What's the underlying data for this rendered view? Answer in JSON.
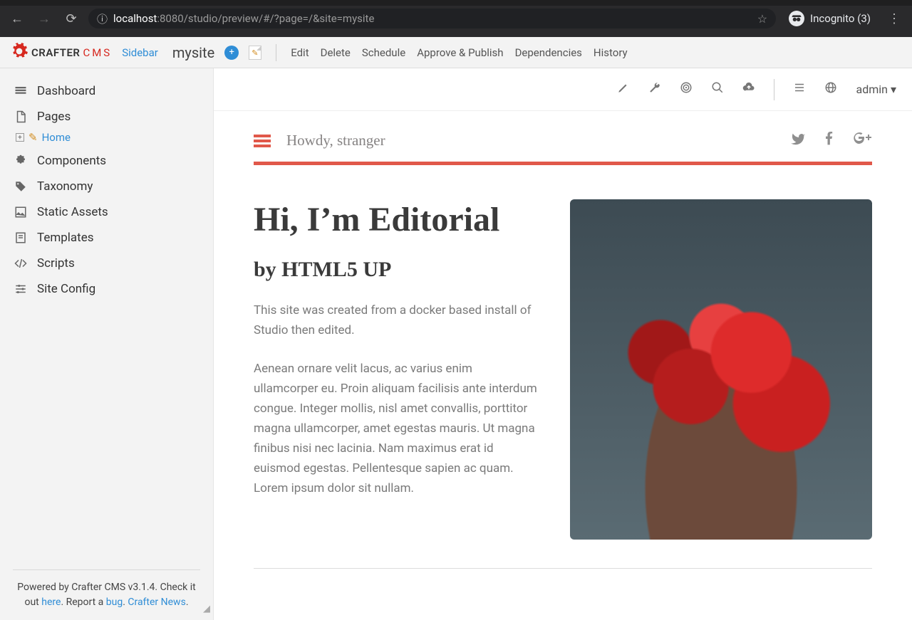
{
  "browser": {
    "url_host": "localhost",
    "url_port_path": ":8080/studio/preview/#/?page=/&site=mysite",
    "incognito_label": "Incognito (3)"
  },
  "topbar": {
    "sidebar_toggle": "Sidebar",
    "site_name": "mysite",
    "actions": {
      "edit": "Edit",
      "delete": "Delete",
      "schedule": "Schedule",
      "approve_publish": "Approve & Publish",
      "dependencies": "Dependencies",
      "history": "History"
    }
  },
  "sidebar": {
    "items": {
      "dashboard": "Dashboard",
      "pages": "Pages",
      "home": "Home",
      "components": "Components",
      "taxonomy": "Taxonomy",
      "static_assets": "Static Assets",
      "templates": "Templates",
      "scripts": "Scripts",
      "site_config": "Site Config"
    },
    "footer": {
      "p1a": "Powered by Crafter CMS v3.1.4. Check it out ",
      "here": "here",
      "p1b": ". Report a ",
      "bug": "bug",
      "p1c": ". ",
      "news": "Crafter News",
      "p1d": "."
    }
  },
  "toolbar": {
    "user_label": "admin"
  },
  "preview": {
    "greeting": "Howdy, stranger",
    "title": "Hi, I’m Editorial",
    "subtitle": "by HTML5 UP",
    "para1": "This site was created from a docker based install of Studio then edited.",
    "para2": "Aenean ornare velit lacus, ac varius enim ullamcorper eu. Proin aliquam facilisis ante interdum congue. Integer mollis, nisl amet convallis, porttitor magna ullamcorper, amet egestas mauris. Ut magna finibus nisi nec lacinia. Nam maximus erat id euismod egestas. Pellentesque sapien ac quam. Lorem ipsum dolor sit nullam."
  }
}
